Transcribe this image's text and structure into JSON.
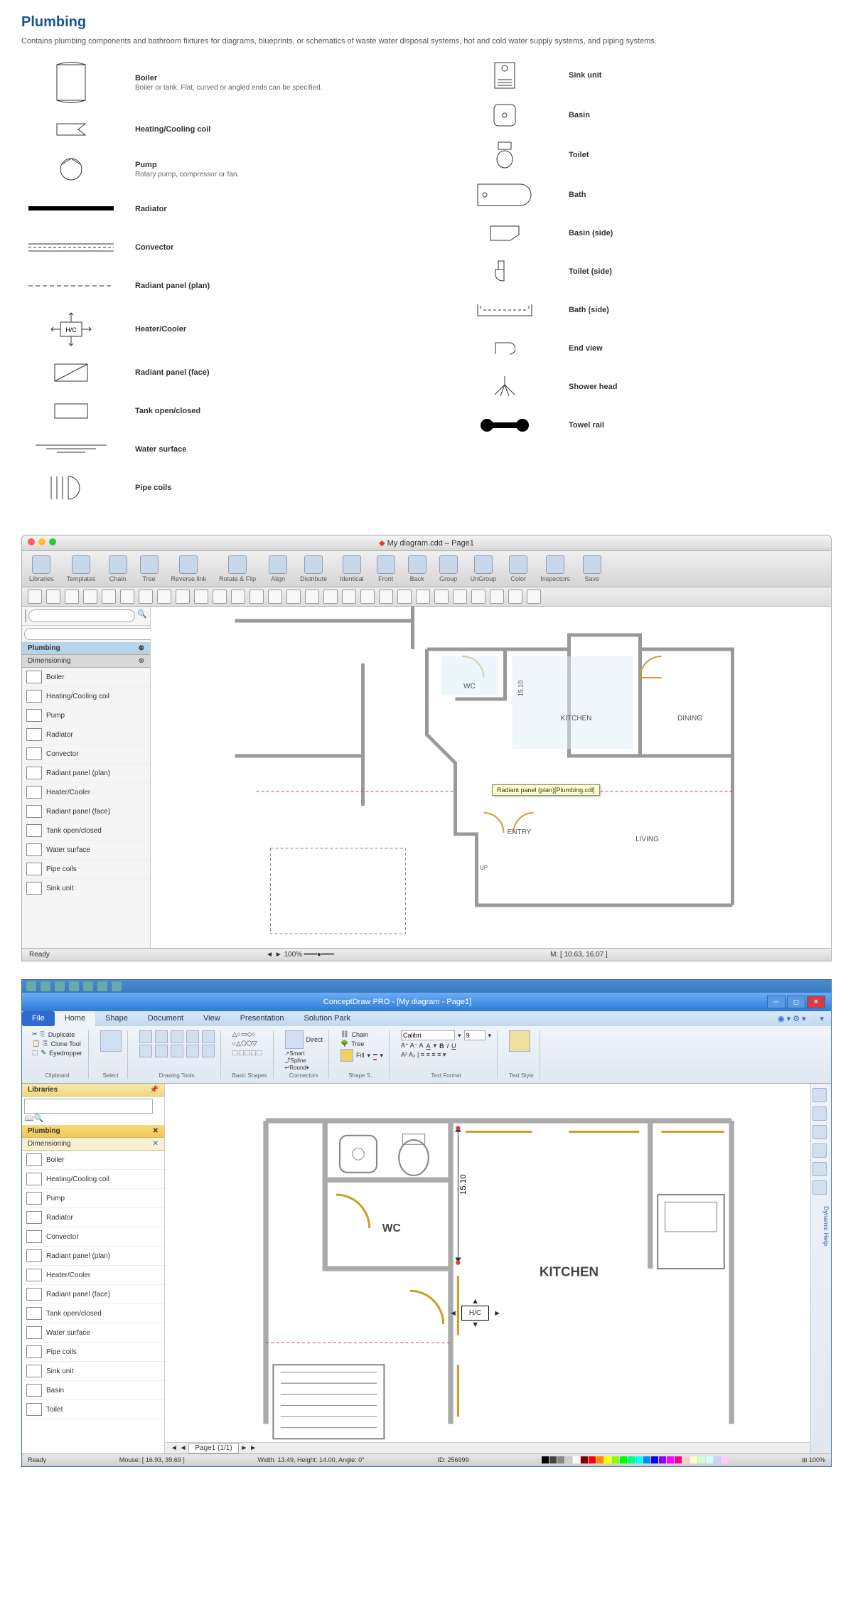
{
  "title": "Plumbing",
  "description": "Contains plumbing components and bathroom fixtures for diagrams, blueprints, or schematics of waste water disposal systems, hot and cold water supply systems, and piping systems.",
  "legend": {
    "left": [
      {
        "name": "Boiler",
        "desc": "Boiler or tank. Flat, curved or angled ends can be specified."
      },
      {
        "name": "Heating/Cooling coil"
      },
      {
        "name": "Pump",
        "desc": "Rotary pump, compressor or fan."
      },
      {
        "name": "Radiator"
      },
      {
        "name": "Convector"
      },
      {
        "name": "Radiant panel (plan)"
      },
      {
        "name": "Heater/Cooler"
      },
      {
        "name": "Radiant panel (face)"
      },
      {
        "name": "Tank open/closed"
      },
      {
        "name": "Water surface"
      },
      {
        "name": "Pipe coils"
      }
    ],
    "right": [
      {
        "name": "Sink unit"
      },
      {
        "name": "Basin"
      },
      {
        "name": "Toilet"
      },
      {
        "name": "Bath"
      },
      {
        "name": "Basin (side)"
      },
      {
        "name": "Toilet (side)"
      },
      {
        "name": "Bath (side)"
      },
      {
        "name": "End view"
      },
      {
        "name": "Shower head"
      },
      {
        "name": "Towel rail"
      }
    ]
  },
  "mac": {
    "title": "My diagram.cdd – Page1",
    "toolbar": [
      "Libraries",
      "Templates",
      "Chain",
      "Tree",
      "Reverse link",
      "Rotate & Flip",
      "Align",
      "Distribute",
      "Identical",
      "Front",
      "Back",
      "Group",
      "UnGroup",
      "Color",
      "Inspectors",
      "Save"
    ],
    "sidebar": {
      "tab1": "Plumbing",
      "tab2": "Dimensioning",
      "items": [
        "Boiler",
        "Heating/Cooling coil",
        "Pump",
        "Radiator",
        "Convector",
        "Radiant panel (plan)",
        "Heater/Cooler",
        "Radiant panel (face)",
        "Tank open/closed",
        "Water surface",
        "Pipe coils",
        "Sink unit"
      ]
    },
    "rooms": {
      "wc": "WC",
      "kitchen": "KITCHEN",
      "dining": "DINING",
      "entry": "ENTRY",
      "living": "LIVING",
      "up": "UP",
      "dim": "15.10"
    },
    "tooltip": "Radiant panel (plan)[Plumbing.cdl]",
    "status": {
      "ready": "Ready",
      "zoom": "100%",
      "mouse": "M: [ 10.63, 16.07 ]"
    }
  },
  "win": {
    "title": "ConceptDraw PRO - [My diagram - Page1]",
    "tabs": [
      "Home",
      "Shape",
      "Document",
      "View",
      "Presentation",
      "Solution Park"
    ],
    "file": "File",
    "ribbon": {
      "clipboard": {
        "label": "Clipboard",
        "dup": "Duplicate",
        "clone": "Clone Tool",
        "eye": "Eyedropper"
      },
      "select": "Select",
      "drawing": "Drawing Tools",
      "shapes": "Basic Shapes",
      "connectors": {
        "label": "Connectors",
        "direct": "Direct",
        "smart": "Smart",
        "spline": "Spline",
        "round": "Round"
      },
      "shapestyle": {
        "label": "Shape S...",
        "chain": "Chain",
        "tree": "Tree",
        "fill": "Fill"
      },
      "font": {
        "label": "Text Format",
        "name": "Calibri",
        "size": "9"
      },
      "text": "Text Style"
    },
    "sidebar": {
      "hdr": "Libraries",
      "tab1": "Plumbing",
      "tab2": "Dimensioning",
      "items": [
        "Boiler",
        "Heating/Cooling coil",
        "Pump",
        "Radiator",
        "Convector",
        "Radiant panel (plan)",
        "Heater/Cooler",
        "Radiant panel (face)",
        "Tank open/closed",
        "Water surface",
        "Pipe coils",
        "Sink unit",
        "Basin",
        "Toilet"
      ]
    },
    "rooms": {
      "wc": "WC",
      "kitchen": "KITCHEN",
      "dim": "15.10",
      "hc": "H/C"
    },
    "tabbar": "Page1 (1/1)",
    "status": {
      "ready": "Ready",
      "mouse": "Mouse: [ 16.93, 39.69 ]",
      "dims": "Width: 13.49,  Height: 14.00,  Angle: 0°",
      "id": "ID: 256999",
      "zoom": "100%"
    },
    "helptab": "Dynamic Help"
  }
}
